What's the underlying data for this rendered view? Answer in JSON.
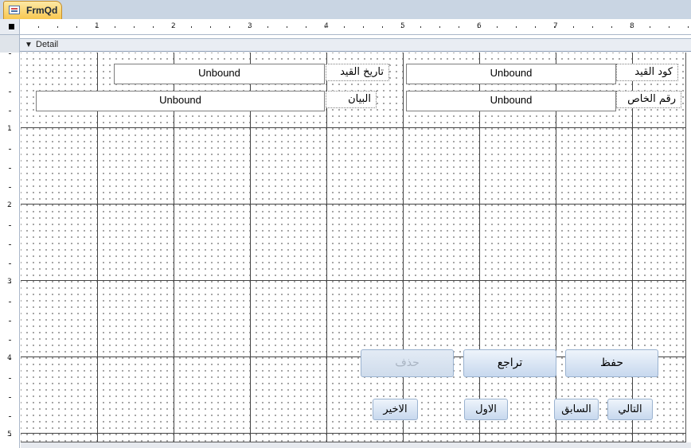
{
  "tab": {
    "title": "FrmQd",
    "icon": "form-icon"
  },
  "ruler": {
    "h_labels": [
      "1",
      "2",
      "3",
      "4",
      "5",
      "6",
      "7",
      "8"
    ],
    "v_labels": [
      "1",
      "2",
      "3",
      "4",
      "5"
    ]
  },
  "section": {
    "label": "Detail",
    "icon": "section-collapse-icon"
  },
  "fields": {
    "entry_code": {
      "label": "كود القيد",
      "value": "Unbound"
    },
    "entry_date": {
      "label": "تاريخ القيد",
      "value": "Unbound"
    },
    "private_number": {
      "label": "رقم الخاص",
      "value": "Unbound"
    },
    "description": {
      "label": "البيان",
      "value": "Unbound"
    }
  },
  "buttons": {
    "save": "حفظ",
    "undo": "تراجع",
    "delete": "حذف",
    "next": "التالي",
    "previous": "السابق",
    "first": "الاول",
    "last": "الاخير"
  }
}
